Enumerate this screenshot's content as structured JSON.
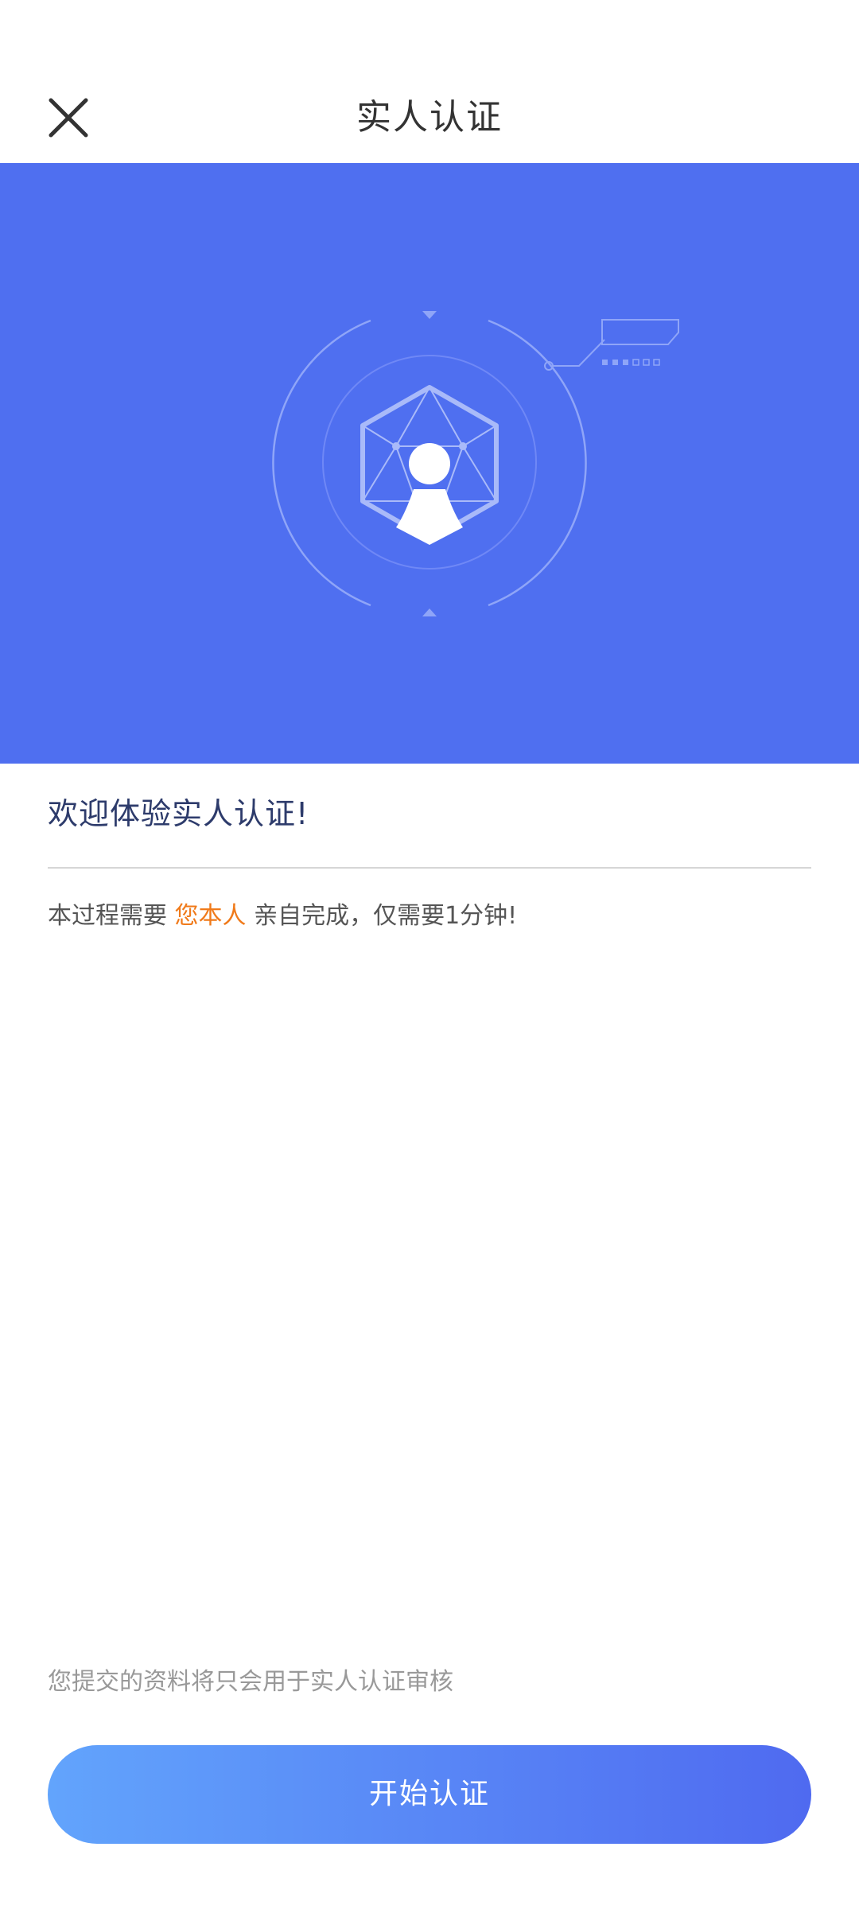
{
  "header": {
    "title": "实人认证",
    "close_icon": "close-icon"
  },
  "banner": {
    "background_color": "#4f6ff0",
    "illustration": "face-verification-illustration"
  },
  "welcome": {
    "title": "欢迎体验实人认证!",
    "desc_prefix": "本过程需要",
    "desc_highlight": "您本人",
    "desc_suffix": "亲自完成，仅需要1分钟!"
  },
  "footer": {
    "privacy_note": "您提交的资料将只会用于实人认证审核",
    "start_button_label": "开始认证"
  },
  "colors": {
    "accent": "#4f6ff0",
    "highlight": "#f07a1a",
    "button_gradient_start": "#62a4fc",
    "button_gradient_end": "#4f6af0"
  }
}
